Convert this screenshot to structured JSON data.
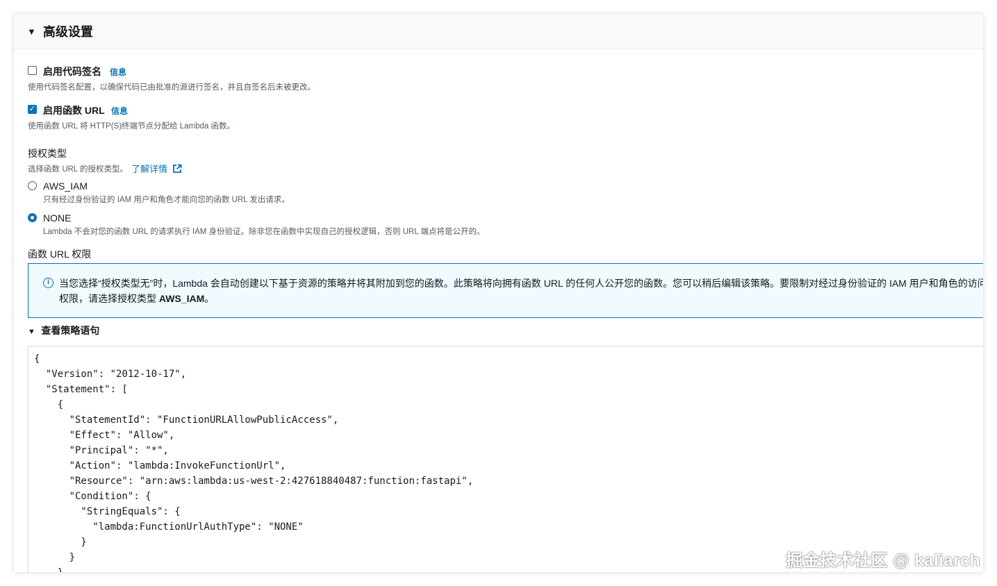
{
  "section": {
    "title": "高级设置"
  },
  "code_signing": {
    "label": "启用代码签名",
    "info": "信息",
    "checked": false,
    "description": "使用代码签名配置，以确保代码已由批准的源进行签名，并且自签名后未被更改。"
  },
  "function_url": {
    "label": "启用函数 URL",
    "info": "信息",
    "checked": true,
    "description": "使用函数 URL 将 HTTP(S)终端节点分配给 Lambda 函数。"
  },
  "auth_type": {
    "label": "授权类型",
    "description": "选择函数 URL 的授权类型。",
    "learn_more": "了解详情",
    "options": [
      {
        "label": "AWS_IAM",
        "description": "只有经过身份验证的 IAM 用户和角色才能向您的函数 URL 发出请求。",
        "selected": false
      },
      {
        "label": "NONE",
        "description": "Lambda 不会对您的函数 URL 的请求执行 IAM 身份验证。除非您在函数中实现自己的授权逻辑，否则 URL 端点将是公开的。",
        "selected": true
      }
    ]
  },
  "permissions": {
    "label": "函数 URL 权限",
    "alert_line1": "当您选择“授权类型无”时，Lambda 会自动创建以下基于资源的策略并将其附加到您的函数。此策略将向拥有函数 URL 的任何人公开您的函数。您可以稍后编辑该策略。要限制对经过身份验证的 IAM 用户和角色的访问",
    "alert_line2_prefix": "权限，请选择授权类型 ",
    "alert_line2_bold": "AWS_IAM",
    "alert_line2_suffix": "。"
  },
  "policy": {
    "toggle_label": "查看策略语句",
    "code": "{\n  \"Version\": \"2012-10-17\",\n  \"Statement\": [\n    {\n      \"StatementId\": \"FunctionURLAllowPublicAccess\",\n      \"Effect\": \"Allow\",\n      \"Principal\": \"*\",\n      \"Action\": \"lambda:InvokeFunctionUrl\",\n      \"Resource\": \"arn:aws:lambda:us-west-2:427618840487:function:fastapi\",\n      \"Condition\": {\n        \"StringEquals\": {\n          \"lambda:FunctionUrlAuthType\": \"NONE\"\n        }\n      }\n    }"
  },
  "watermark": "掘金技术社区 @ kaliarch",
  "colors": {
    "accent": "#0073bb",
    "alert_bg": "#f1faff",
    "text": "#16191f",
    "muted": "#545b64"
  }
}
